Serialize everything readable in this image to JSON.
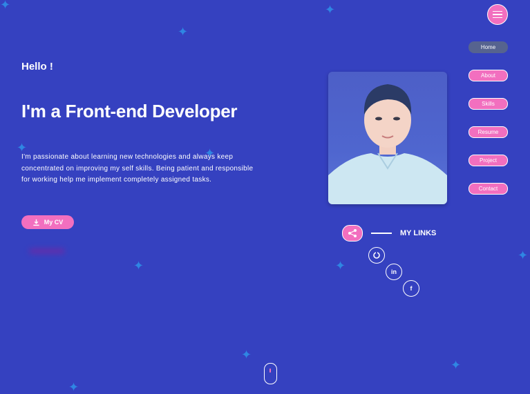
{
  "hero": {
    "greeting": "Hello !",
    "title": "I'm a Front-end Developer",
    "description": "I'm passionate about learning new technologies and always keep concentrated on improving my self skills. Being patient and responsible for working help me implement completely assigned tasks.",
    "cv_button": "My CV"
  },
  "nav": {
    "items": [
      "Home",
      "About",
      "Skills",
      "Resume",
      "Project",
      "Contact"
    ],
    "active": "Home"
  },
  "links": {
    "label": "MY LINKS"
  },
  "icons": {
    "menu": "hamburger-menu-icon",
    "download": "download-icon",
    "share": "share-icon",
    "socials": [
      "github-icon",
      "linkedin-icon",
      "facebook-icon"
    ],
    "scroll": "mouse-scroll-icon"
  },
  "colors": {
    "background": "#3541c0",
    "accent": "#f26fbf",
    "nav_active": "#56638f",
    "star": "#2f86e3"
  }
}
